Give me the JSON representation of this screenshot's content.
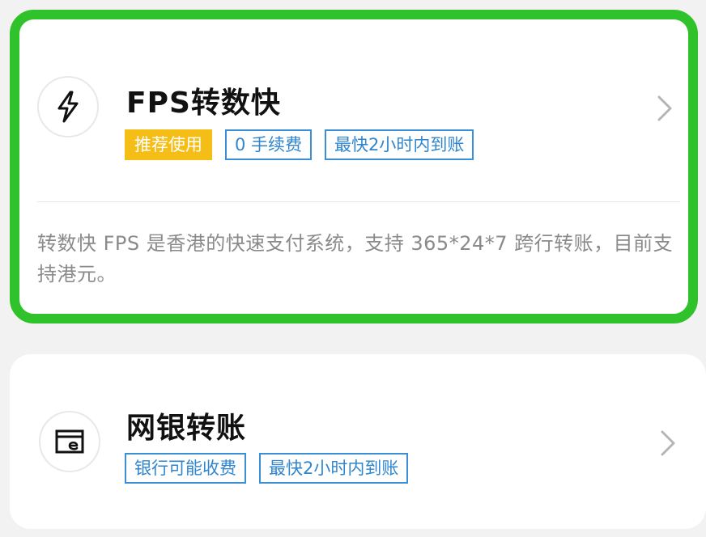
{
  "options": [
    {
      "id": "fps",
      "title": "FPS转数快",
      "icon": "lightning-icon",
      "selected": true,
      "tags": [
        {
          "label": "推荐使用",
          "style": "filled"
        },
        {
          "label": "0 手续费",
          "style": "outline"
        },
        {
          "label": "最快2小时内到账",
          "style": "outline"
        }
      ],
      "description": "转数快 FPS 是香港的快速支付系统，支持 365*24*7 跨行转账，目前支持港元。"
    },
    {
      "id": "ebank",
      "title": "网银转账",
      "icon": "online-banking-icon",
      "selected": false,
      "tags": [
        {
          "label": "银行可能收费",
          "style": "outline"
        },
        {
          "label": "最快2小时内到账",
          "style": "outline"
        }
      ]
    }
  ],
  "colors": {
    "selected_border": "#2fc22a",
    "tag_outline": "#3a8fd6",
    "tag_filled": "#f5be16",
    "description_text": "#8a8a8a"
  }
}
